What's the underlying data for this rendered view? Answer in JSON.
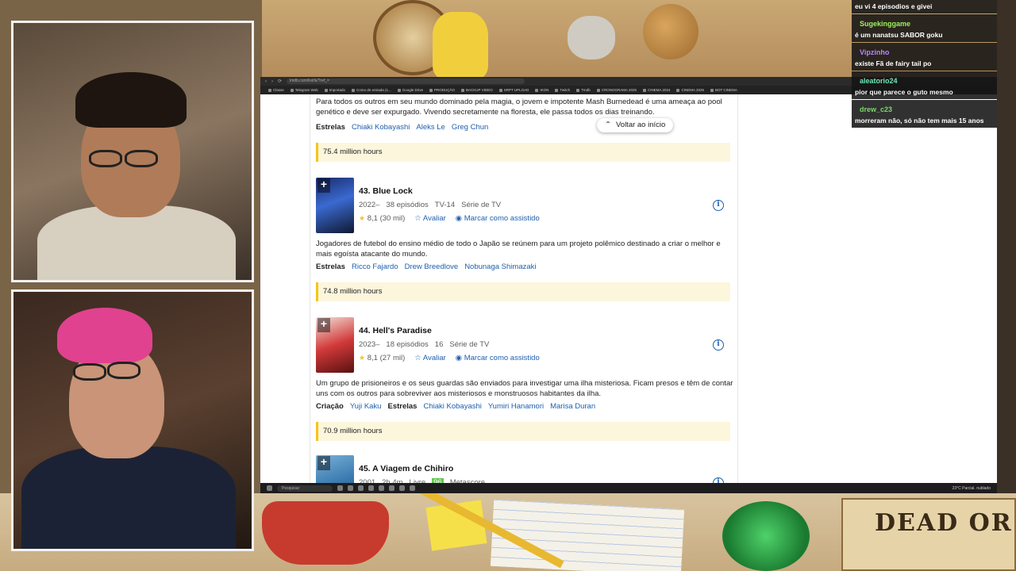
{
  "chat": [
    {
      "user": "",
      "text": "eu vi 4 episodios e givei",
      "color": "#ffffff"
    },
    {
      "user": "Sugekinggame",
      "text": "é um nanatsu SABOR goku",
      "color": "#9ef05a"
    },
    {
      "user": "Vipzinho",
      "text": "existe Fã de fairy tail po",
      "color": "#b985ff"
    },
    {
      "user": "aleatorio24",
      "text": "pior que parece o guto mesmo",
      "color": "#6ee7b7"
    },
    {
      "user": "drew_c23",
      "text": "morreram não, só não tem mais 15 anos",
      "color": "#7bd86a"
    }
  ],
  "browser": {
    "url": "imdb.com/list/ls/?ref_=",
    "bookmarks": [
      "Classe",
      "Telegram Web",
      "Importado",
      "Como de entrada (1...",
      "Google Drive",
      "PRODUÇÃO",
      "BACKUP VIDEO",
      "SRPT UPLOAD",
      "IKON",
      "Twitch",
      "Tmdb",
      "CRONOGRAMA 2025",
      "CINEMA 2024",
      "CINEMA 2025",
      "BOT CINEMA"
    ],
    "taskbar_search": "Pesquisar",
    "taskbar_clock": "23°C Parcial. nublado",
    "back_to_top": "Voltar ao início"
  },
  "list": {
    "prev": {
      "description": "Para todos os outros em seu mundo dominado pela magia, o jovem e impotente Mash Burnedead é uma ameaça ao pool genético e deve ser expurgado. Vivendo secretamente na floresta, ele passa todos os dias treinando.",
      "stars_label": "Estrelas",
      "stars": [
        "Chiaki Kobayashi",
        "Aleks Le",
        "Greg Chun"
      ],
      "hours": "75.4 million hours"
    },
    "items": [
      {
        "title": "43. Blue Lock",
        "year": "2022–",
        "episodes": "38 episódios",
        "rating_cert": "TV-14",
        "type": "Série de TV",
        "rating": "8,1",
        "votes": "(30 mil)",
        "rate_label": "Avaliar",
        "watched_label": "Marcar como assistido",
        "description": "Jogadores de futebol do ensino médio de todo o Japão se reúnem para um projeto polêmico destinado a criar o melhor e mais egoísta atacante do mundo.",
        "stars_label": "Estrelas",
        "stars": [
          "Ricco Fajardo",
          "Drew Breedlove",
          "Nobunaga Shimazaki"
        ],
        "hours": "74.8 million hours"
      },
      {
        "title": "44. Hell's Paradise",
        "year": "2023–",
        "episodes": "18 episódios",
        "rating_cert": "16",
        "type": "Série de TV",
        "rating": "8,1",
        "votes": "(27 mil)",
        "rate_label": "Avaliar",
        "watched_label": "Marcar como assistido",
        "description": "Um grupo de prisioneiros e os seus guardas são enviados para investigar uma ilha misteriosa. Ficam presos e têm de contar uns com os outros para sobreviver aos misteriosos e monstruosos habitantes da ilha.",
        "creator_label": "Criação",
        "creators": [
          "Yuji Kaku"
        ],
        "stars_label": "Estrelas",
        "stars": [
          "Chiaki Kobayashi",
          "Yumiri Hanamori",
          "Marisa Duran"
        ],
        "hours": "70.9 million hours"
      },
      {
        "title": "45. A Viagem de Chihiro",
        "year": "2001",
        "duration": "2h 4m",
        "rating_cert": "Livre",
        "metascore": "96",
        "metascore_label": "Metascore"
      }
    ]
  },
  "overlay": {
    "wanted_text": "DEAD OR"
  },
  "colors": {
    "imdb_yellow": "#f5c518",
    "link_blue": "#1f5fae"
  }
}
